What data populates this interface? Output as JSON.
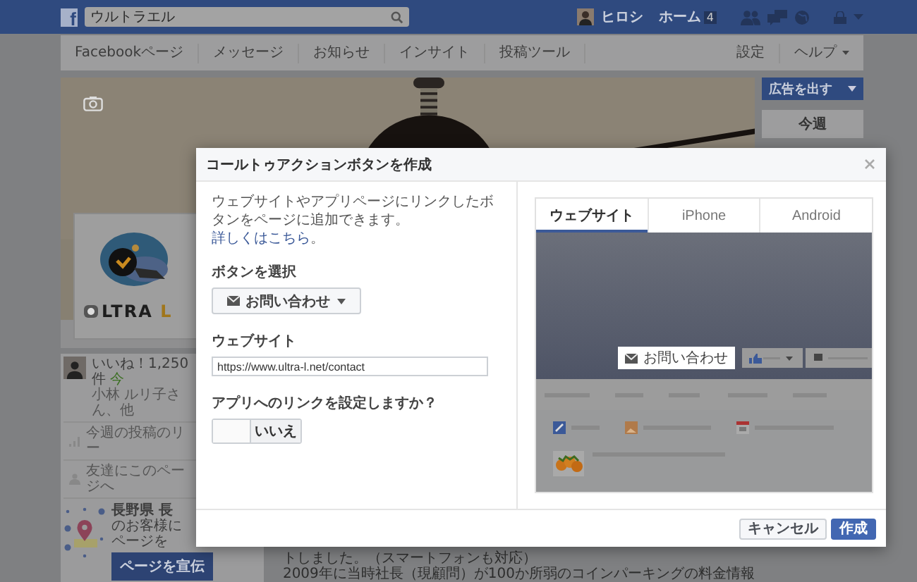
{
  "top_bar": {
    "logo": "f",
    "search": {
      "value": "ウルトラエル"
    },
    "user": {
      "name": "ヒロシ"
    },
    "home": {
      "label": "ホーム",
      "count": "4"
    }
  },
  "page_nav": {
    "items": [
      {
        "label": "Facebookページ"
      },
      {
        "label": "メッセージ"
      },
      {
        "label": "お知らせ"
      },
      {
        "label": "インサイト"
      },
      {
        "label": "投稿ツール"
      }
    ],
    "settings": "設定",
    "help": "ヘルプ"
  },
  "cover": {
    "logo_text": "LTRA",
    "logo_accent": "L"
  },
  "sidebar": {
    "ad_button": "広告を出す",
    "week_heading": "今週"
  },
  "page_summary": {
    "likes": "いいね！1,250件",
    "likes_new": "今",
    "friends": "小林 ルリ子さん、他",
    "reach": "今週の投稿のリー",
    "invite": "友達にこのページへ",
    "promo": {
      "lines": [
        "長野県 長",
        "のお客様に",
        "ページを"
      ],
      "button": "ページを宣伝"
    }
  },
  "post": {
    "lines": [
      "トしました。（スマートフォンも対応）",
      "2009年に当時社長（現顧問）が100か所弱のコインパーキングの料金情報"
    ]
  },
  "dialog": {
    "title": "コールトゥアクションボタンを作成",
    "description": "ウェブサイトやアプリページにリンクしたボタンをページに追加できます。",
    "learn_more": "詳しくはこちら",
    "description_end": "。",
    "button_select": {
      "label": "ボタンを選択",
      "value": "お問い合わせ"
    },
    "website": {
      "label": "ウェブサイト",
      "value": "https://www.ultra-l.net/contact"
    },
    "app_link": {
      "label": "アプリへのリンクを設定しますか？",
      "on": false,
      "state_label": "いいえ"
    },
    "preview": {
      "tabs": [
        {
          "label": "ウェブサイト",
          "selected": true
        },
        {
          "label": "iPhone",
          "selected": false
        },
        {
          "label": "Android",
          "selected": false
        }
      ],
      "cta_button": "お問い合わせ"
    },
    "buttons": [
      {
        "label": "キャンセル",
        "kind": "secondary"
      },
      {
        "label": "作成",
        "kind": "primary"
      }
    ]
  }
}
